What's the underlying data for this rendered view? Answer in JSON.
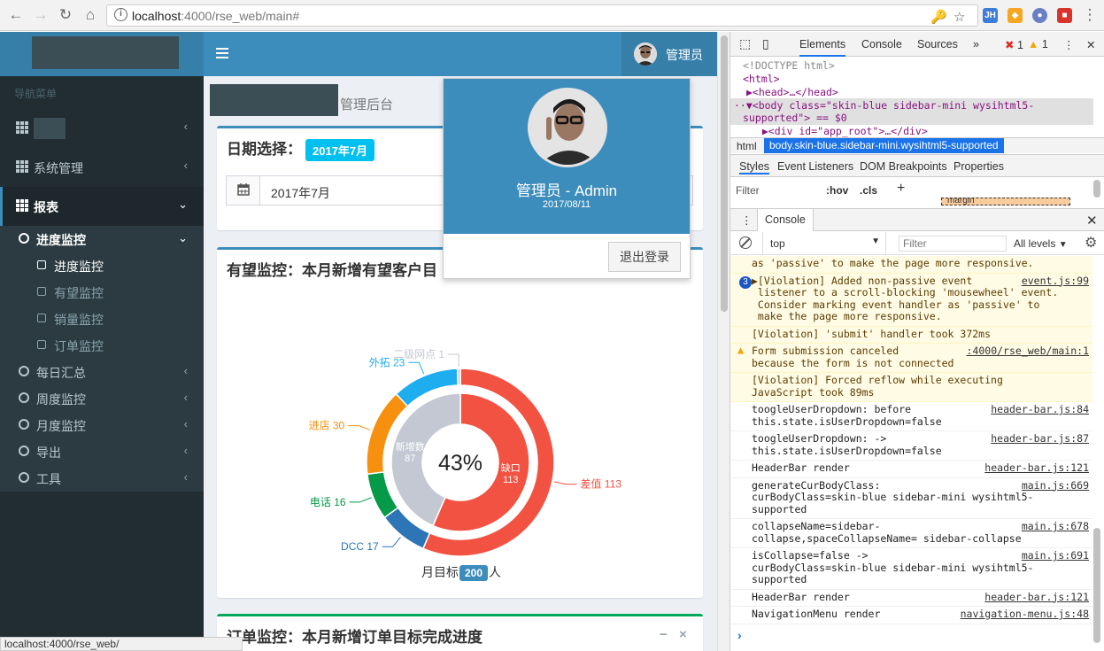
{
  "browser": {
    "url_host": "localhost",
    "url_path": ":4000/rse_web/main#",
    "status_url": "localhost:4000/rse_web/"
  },
  "sidebar": {
    "header": "导航菜单",
    "items": [
      {
        "label": "",
        "icon": "grid-icon"
      },
      {
        "label": "系统管理",
        "icon": "grid-icon"
      },
      {
        "label": "报表",
        "icon": "grid-icon"
      }
    ],
    "report_children": [
      {
        "label": "进度监控",
        "active": true,
        "children": [
          "进度监控",
          "有望监控",
          "销量监控",
          "订单监控"
        ]
      },
      {
        "label": "每日汇总"
      },
      {
        "label": "周度监控"
      },
      {
        "label": "月度监控"
      },
      {
        "label": "导出"
      },
      {
        "label": "工具"
      }
    ]
  },
  "topbar": {
    "user_name": "管理员"
  },
  "content": {
    "breadcrumb": "管理后台",
    "date_box": {
      "title": "日期选择：",
      "badge": "2017年7月",
      "value": "2017年7月"
    },
    "prospect_box": {
      "title": "有望监控：本月新增有望客户目"
    },
    "order_box": {
      "title": "订单监控：本月新增订单目标完成进度"
    },
    "goal": {
      "prefix": "月目标",
      "value": "200",
      "suffix": "人"
    }
  },
  "dropdown": {
    "name": "管理员 - Admin",
    "date": "2017/08/11",
    "logout": "退出登录"
  },
  "chart_data": {
    "type": "pie",
    "title": "",
    "center_label": "43%",
    "outer_ring": [
      {
        "name": "差值",
        "value": 113,
        "color": "#f25242"
      },
      {
        "name": "DCC",
        "value": 17,
        "color": "#2e75b6"
      },
      {
        "name": "电话",
        "value": 16,
        "color": "#059a47"
      },
      {
        "name": "进店",
        "value": 30,
        "color": "#f7900f"
      },
      {
        "name": "外拓",
        "value": 23,
        "color": "#1eaef0"
      },
      {
        "name": "二级网点",
        "value": 1,
        "color": "#c4c8d3"
      }
    ],
    "inner_ring": [
      {
        "name": "缺口",
        "value": 113,
        "color": "#f25242"
      },
      {
        "name": "新增数",
        "value": 87,
        "color": "#c4c8d3"
      }
    ]
  },
  "devtools": {
    "tabs": [
      "Elements",
      "Console",
      "Sources",
      "»"
    ],
    "errors": "1",
    "warnings": "1",
    "dom": [
      "<!DOCTYPE html>",
      "<html>",
      "▶<head>…</head>",
      "▼<body class=\"skin-blue sidebar-mini wysihtml5-",
      "supported\"> == $0",
      "  ▶<div id=\"app_root\">…</div>"
    ],
    "crumbs": [
      "html",
      "body.skin-blue.sidebar-mini.wysihtml5-supported"
    ],
    "style_tabs": [
      "Styles",
      "Event Listeners",
      "DOM Breakpoints",
      "Properties"
    ],
    "filter_placeholder": "Filter",
    "hov": ":hov",
    "cls": ".cls",
    "margin_label": "margin",
    "drawer_tab": "Console",
    "context": "top",
    "levels": "All levels",
    "console": [
      {
        "type": "warn",
        "text": "as 'passive' to make the page more responsive.",
        "src": ""
      },
      {
        "type": "warn",
        "count": "3",
        "text": "▶[Violation] Added non-passive event\n listener to a scroll-blocking 'mousewheel' event.\n Consider marking event handler as 'passive' to\n make the page more responsive.",
        "src": "event.js:99"
      },
      {
        "type": "warn",
        "text": "[Violation] 'submit' handler took 372ms",
        "src": ""
      },
      {
        "type": "warnicon",
        "text": "Form submission canceled\nbecause the form is not connected",
        "src": ":4000/rse_web/main:1"
      },
      {
        "type": "warn",
        "text": "[Violation] Forced reflow while executing\nJavaScript took 89ms",
        "src": ""
      },
      {
        "type": "log",
        "text": "toogleUserDropdown: before\nthis.state.isUserDropdown=false",
        "src": "header-bar.js:84"
      },
      {
        "type": "log",
        "text": "toogleUserDropdown: ->\nthis.state.isUserDropdown=false",
        "src": "header-bar.js:87"
      },
      {
        "type": "log",
        "text": "HeaderBar render",
        "src": "header-bar.js:121"
      },
      {
        "type": "log",
        "text": "generateCurBodyClass:\ncurBodyClass=skin-blue sidebar-mini wysihtml5-\nsupported",
        "src": "main.js:669"
      },
      {
        "type": "log",
        "text": "collapseName=sidebar-\ncollapse,spaceCollapseName= sidebar-collapse",
        "src": "main.js:678"
      },
      {
        "type": "log",
        "text": "isCollapse=false ->\ncurBodyClass=skin-blue sidebar-mini wysihtml5-\nsupported",
        "src": "main.js:691"
      },
      {
        "type": "log",
        "text": "HeaderBar render",
        "src": "header-bar.js:121"
      },
      {
        "type": "log",
        "text": "NavigationMenu render",
        "src": "navigation-menu.js:48"
      }
    ]
  }
}
